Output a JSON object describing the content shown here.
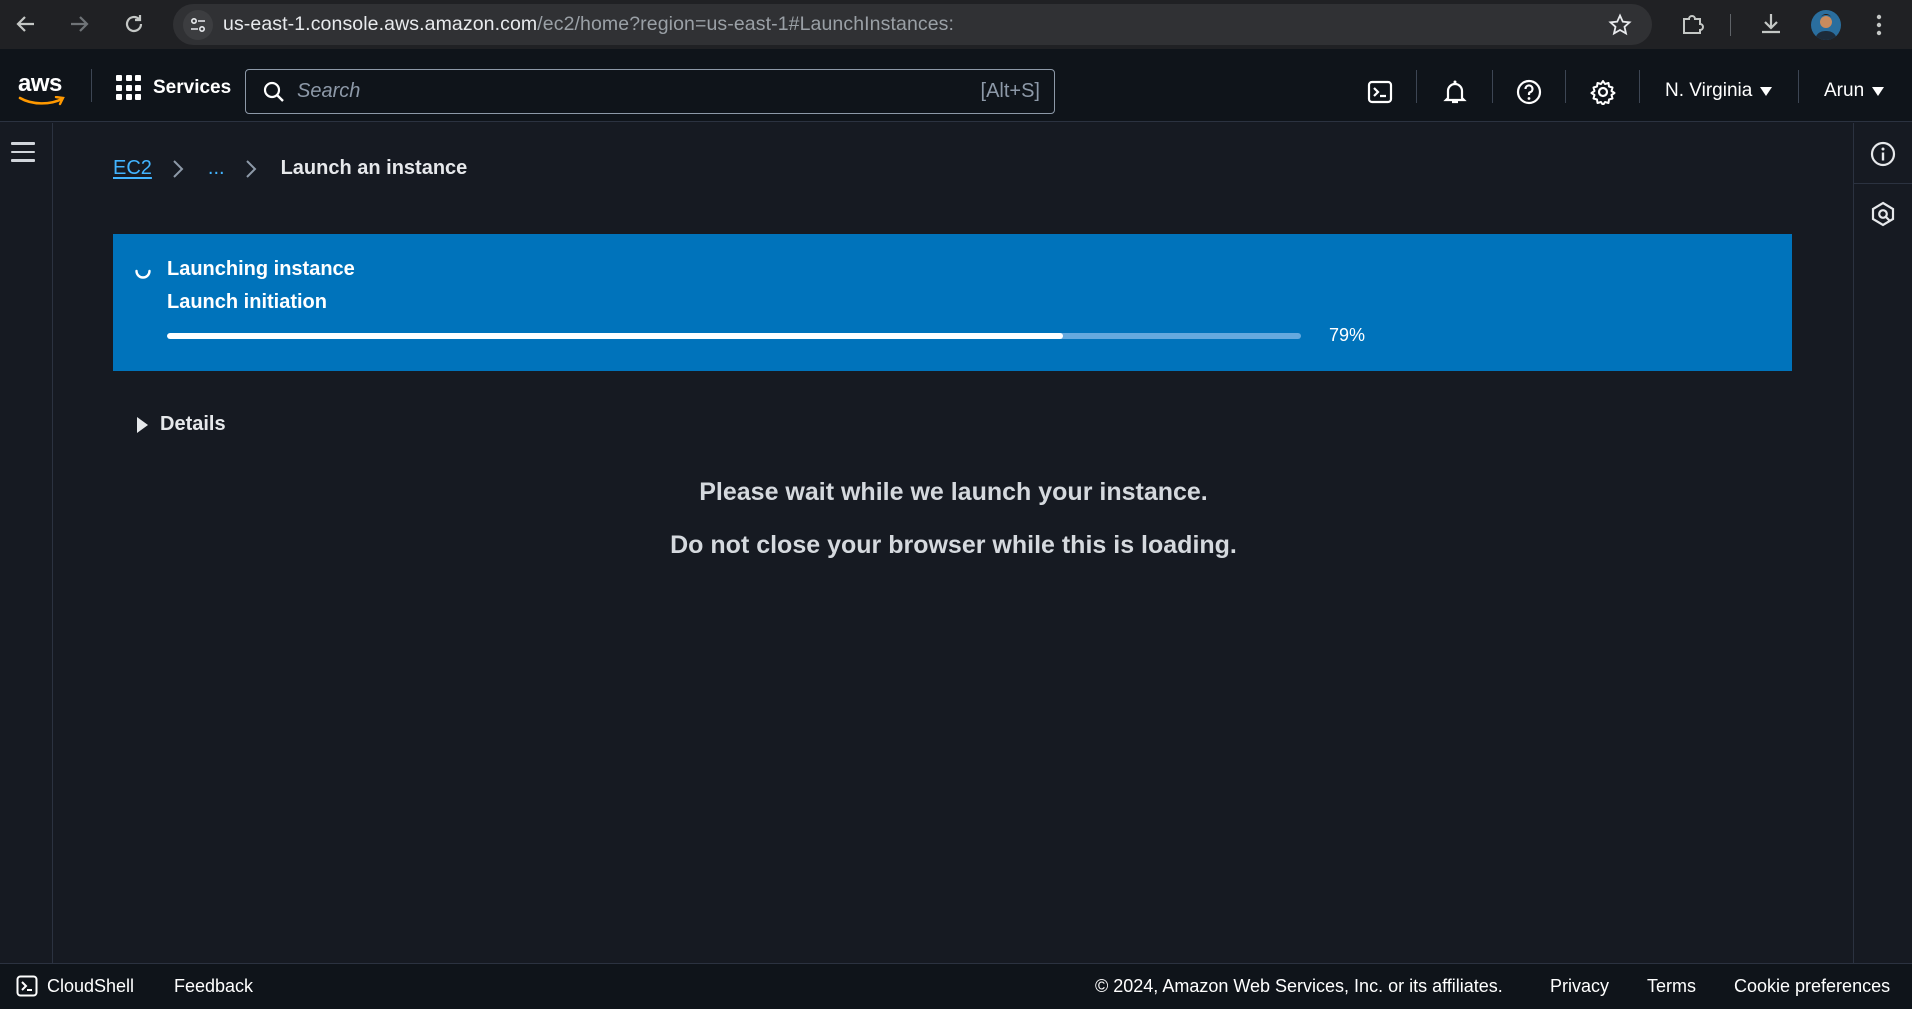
{
  "browser": {
    "url_main": "us-east-1.console.aws.amazon.com",
    "url_rest": "/ec2/home?region=us-east-1#LaunchInstances:"
  },
  "aws": {
    "logo_text": "aws",
    "services_label": "Services",
    "search_placeholder": "Search",
    "search_shortcut": "[Alt+S]",
    "region": "N. Virginia",
    "user": "Arun"
  },
  "breadcrumb": {
    "root": "EC2",
    "ellipsis": "...",
    "current": "Launch an instance"
  },
  "flash": {
    "title": "Launching instance",
    "subtitle": "Launch initiation",
    "progress": 79,
    "progress_label": "79%",
    "color": "#0073bb"
  },
  "details_label": "Details",
  "message": {
    "line1": "Please wait while we launch your instance.",
    "line2": "Do not close your browser while this is loading."
  },
  "footer": {
    "cloudshell": "CloudShell",
    "feedback": "Feedback",
    "copyright": "© 2024, Amazon Web Services, Inc. or its affiliates.",
    "privacy": "Privacy",
    "terms": "Terms",
    "cookie": "Cookie preferences"
  }
}
